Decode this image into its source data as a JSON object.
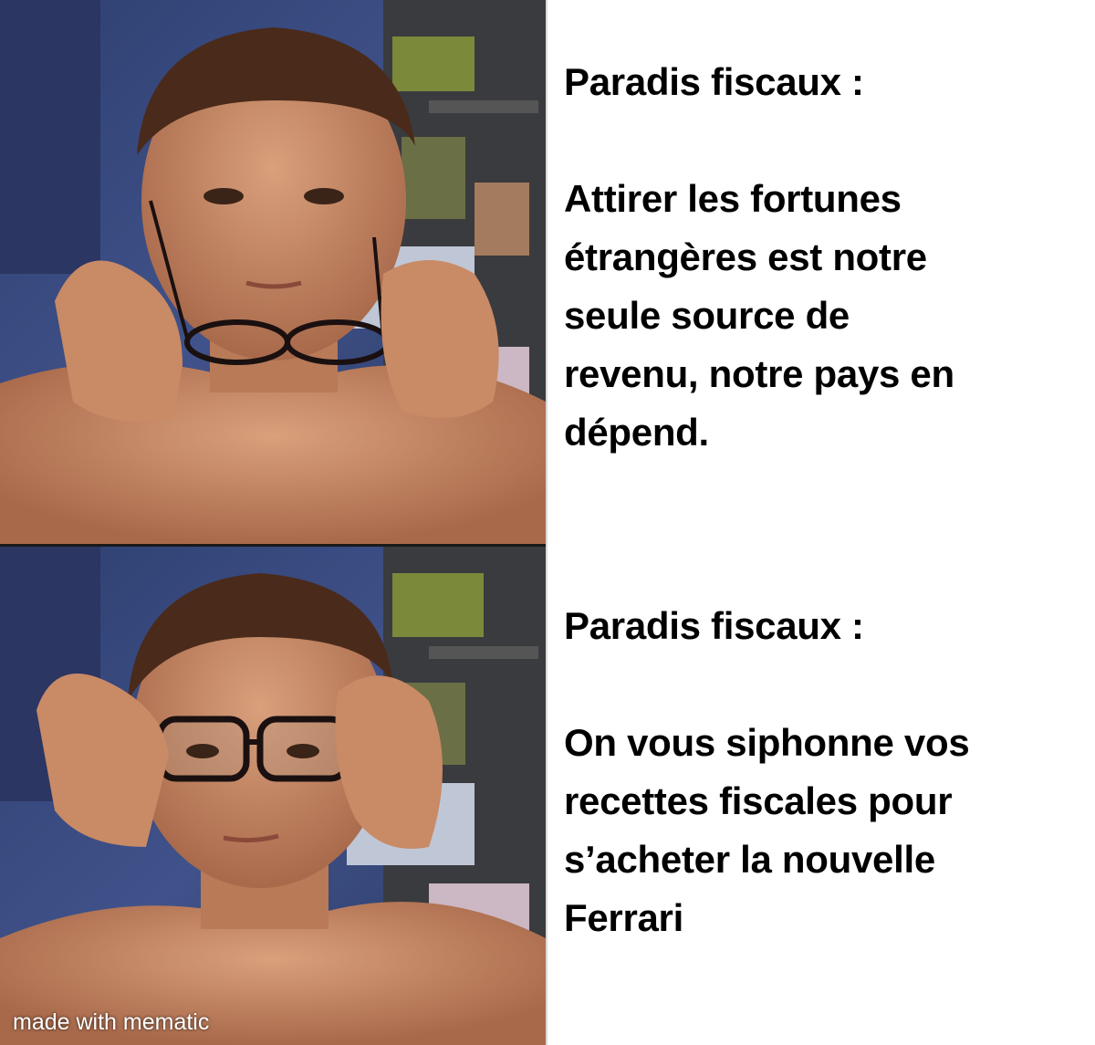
{
  "panels": [
    {
      "heading": "Paradis fiscaux :",
      "body": "Attirer les fortunes\nétrangères est notre\nseule source de\nrevenu, notre pays en\ndépend."
    },
    {
      "heading": "Paradis fiscaux :",
      "body": "On vous siphonne vos\nrecettes fiscales pour\ns’acheter la nouvelle\nFerrari"
    }
  ],
  "watermark": "made with mematic",
  "colors": {
    "caption_text": "#000000",
    "background": "#ffffff",
    "wall_blue": "#3b4a7a",
    "skin": "#c98a66",
    "hair": "#4a2a1a"
  }
}
